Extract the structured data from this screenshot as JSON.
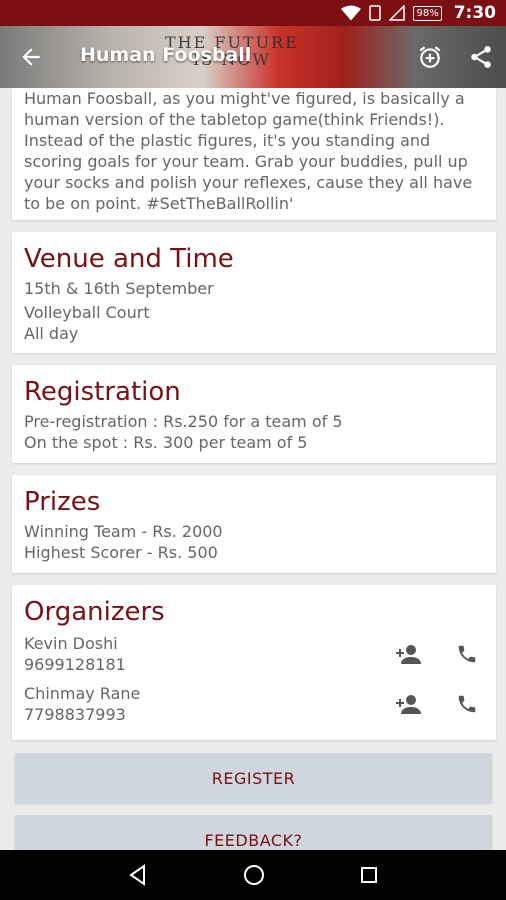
{
  "status": {
    "time": "7:30",
    "battery": "98%"
  },
  "toolbar": {
    "title": "Human Foosball",
    "banner_line1": "THE FUTURE",
    "banner_line2": "IS NOW"
  },
  "description": "Human Foosball, as you might've figured, is basically a human version of the tabletop game(think Friends!). Instead of the plastic figures, it's you standing and scoring goals for your team. Grab your buddies, pull up your socks and polish your reflexes, cause they all have to be on point. #SetTheBallRollin'",
  "venue": {
    "heading": "Venue and Time",
    "date": "15th & 16th September",
    "place": "Volleyball Court",
    "time": "All day"
  },
  "registration": {
    "heading": "Registration",
    "pre": "Pre-registration : Rs.250 for a team of 5",
    "spot": "On the spot : Rs. 300 per team of 5"
  },
  "prizes": {
    "heading": "Prizes",
    "team": "Winning Team - Rs. 2000",
    "scorer": "Highest Scorer - Rs. 500"
  },
  "organizers": {
    "heading": "Organizers",
    "people": [
      {
        "name": "Kevin Doshi",
        "phone": "9699128181"
      },
      {
        "name": "Chinmay Rane",
        "phone": "7798837993"
      }
    ]
  },
  "buttons": {
    "register": "REGISTER",
    "feedback": "FEEDBACK?"
  },
  "colors": {
    "accent": "#7a1016",
    "statusbar": "#7b0f14",
    "button_bg": "#d0d6dd"
  }
}
